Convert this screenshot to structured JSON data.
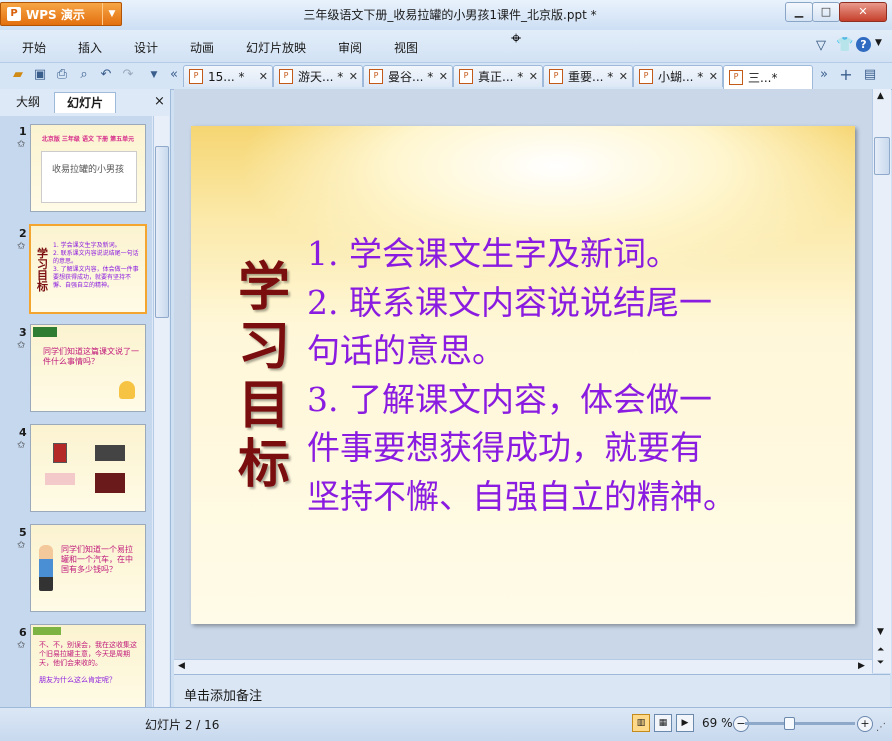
{
  "window": {
    "app_name": "WPS 演示",
    "app_logo": "P",
    "title": "三年级语文下册_收易拉罐的小男孩1课件_北京版.ppt *",
    "help": "?"
  },
  "menu": [
    "开始",
    "插入",
    "设计",
    "动画",
    "幻灯片放映",
    "审阅",
    "视图"
  ],
  "doc_tabs": [
    {
      "label": "15... *",
      "active": false
    },
    {
      "label": "游天... *",
      "active": false
    },
    {
      "label": "曼谷... *",
      "active": false
    },
    {
      "label": "真正... *",
      "active": false
    },
    {
      "label": "重要... *",
      "active": false
    },
    {
      "label": "小蝴... *",
      "active": false
    },
    {
      "label": "三...*",
      "active": true
    }
  ],
  "panel": {
    "tab_outline": "大纲",
    "tab_slides": "幻灯片",
    "close": "×"
  },
  "thumbnails": [
    {
      "num": "1",
      "line1": "北京版 三年级 语文 下册 第五单元",
      "line2": "收易拉罐的小男孩"
    },
    {
      "num": "2",
      "title": "学习目标",
      "lines": [
        "1. 学会课文生字及新词。",
        "2. 联系课文内容说说结尾一句话的意思。",
        "3. 了解课文内容，体会做一件事要想获得成功，就要有坚持不懈、自强自立的精神。"
      ]
    },
    {
      "num": "3",
      "text": "同学们知道这篇课文说了一件什么事情吗？"
    },
    {
      "num": "4"
    },
    {
      "num": "5",
      "text": "同学们知道一个易拉罐和一个汽车，在中国有多少钱吗？"
    },
    {
      "num": "6",
      "text": "不、不，别误会，我在这收集这个旧易拉罐主意，今天是周期天，他们会来收的。",
      "text2": "朋友为什么这么肯定呢？"
    }
  ],
  "slide": {
    "title": "学习目标",
    "objectives": [
      "1. 学会课文生字及新词。",
      "2. 联系课文内容说说结尾一",
      "句话的意思。",
      "3. 了解课文内容，体会做一",
      "件事要想获得成功，就要有",
      "坚持不懈、自强自立的精神。"
    ]
  },
  "notes_placeholder": "单击添加备注",
  "status": {
    "slide_counter": "幻灯片 2 / 16",
    "zoom": "69 %"
  }
}
